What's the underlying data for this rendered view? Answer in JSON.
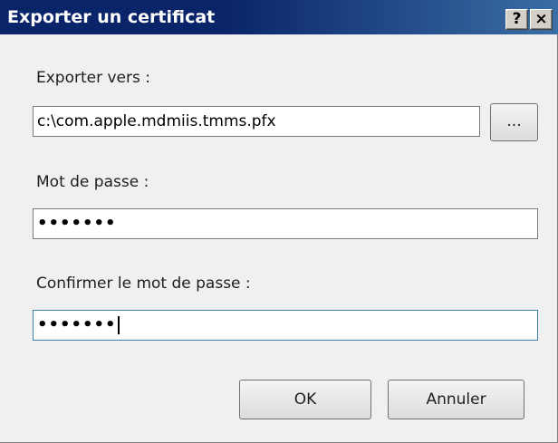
{
  "window": {
    "title": "Exporter un certificat",
    "help_glyph": "?",
    "close_glyph": "×"
  },
  "export": {
    "label": "Exporter vers :",
    "path_value": "c:\\com.apple.mdmiis.tmms.pfx",
    "browse_label": "..."
  },
  "password": {
    "label": "Mot de passe :",
    "masked_value": "•••••••"
  },
  "confirm": {
    "label": "Confirmer le mot de passe :",
    "masked_value": "•••••••"
  },
  "buttons": {
    "ok_label": "OK",
    "cancel_label": "Annuler"
  }
}
